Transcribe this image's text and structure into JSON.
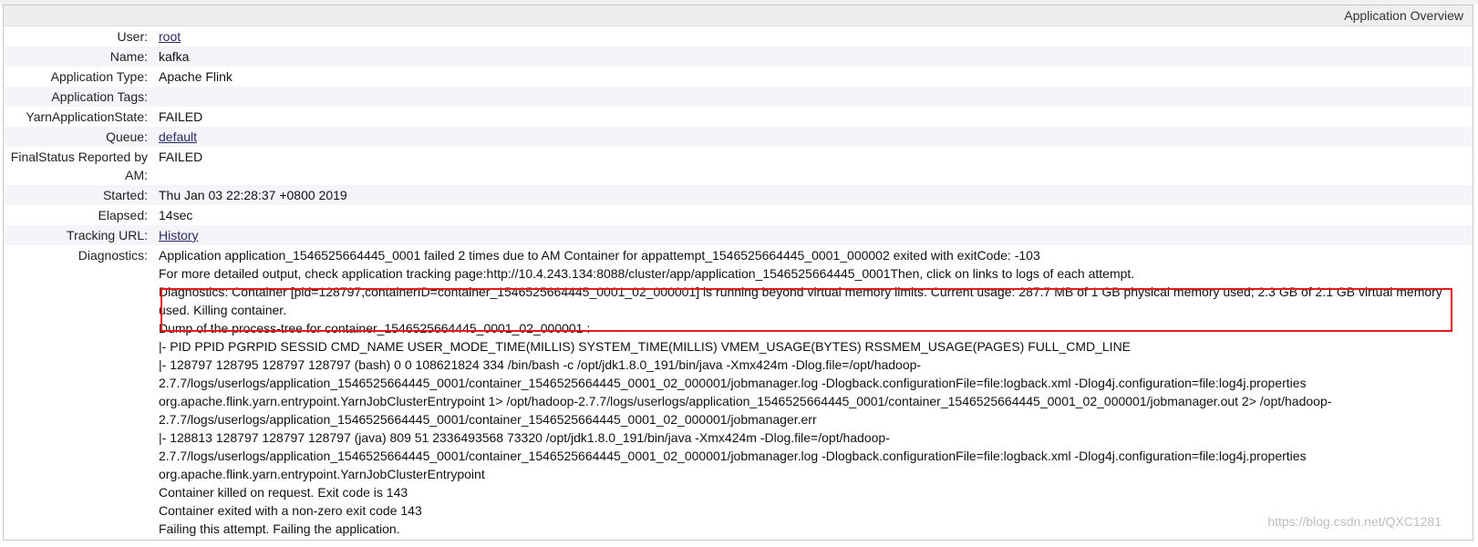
{
  "header": {
    "title": "Application Overview"
  },
  "fields": {
    "user": {
      "label": "User:",
      "value": "root"
    },
    "name": {
      "label": "Name:",
      "value": "kafka"
    },
    "app_type": {
      "label": "Application Type:",
      "value": "Apache Flink"
    },
    "app_tags": {
      "label": "Application Tags:",
      "value": ""
    },
    "yarn_state": {
      "label": "YarnApplicationState:",
      "value": "FAILED"
    },
    "queue": {
      "label": "Queue:",
      "value": "default"
    },
    "final_status": {
      "label": "FinalStatus Reported by AM:",
      "value": "FAILED"
    },
    "started": {
      "label": "Started:",
      "value": "Thu Jan 03 22:28:37 +0800 2019"
    },
    "elapsed": {
      "label": "Elapsed:",
      "value": "14sec"
    },
    "tracking_url": {
      "label": "Tracking URL:",
      "value": "History"
    },
    "diagnostics": {
      "label": "Diagnostics:",
      "lines": [
        "Application application_1546525664445_0001 failed 2 times due to AM Container for appattempt_1546525664445_0001_000002 exited with exitCode: -103",
        "For more detailed output, check application tracking page:http://10.4.243.134:8088/cluster/app/application_1546525664445_0001Then, click on links to logs of each attempt.",
        "Diagnostics: Container [pid=128797,containerID=container_1546525664445_0001_02_000001] is running beyond virtual memory limits. Current usage: 287.7 MB of 1 GB physical memory used; 2.3 GB of 2.1 GB virtual memory used. Killing container.",
        "Dump of the process-tree for container_1546525664445_0001_02_000001 :",
        "|- PID PPID PGRPID SESSID CMD_NAME USER_MODE_TIME(MILLIS) SYSTEM_TIME(MILLIS) VMEM_USAGE(BYTES) RSSMEM_USAGE(PAGES) FULL_CMD_LINE",
        "|- 128797 128795 128797 128797 (bash) 0 0 108621824 334 /bin/bash -c /opt/jdk1.8.0_191/bin/java -Xmx424m -Dlog.file=/opt/hadoop-2.7.7/logs/userlogs/application_1546525664445_0001/container_1546525664445_0001_02_000001/jobmanager.log -Dlogback.configurationFile=file:logback.xml -Dlog4j.configuration=file:log4j.properties org.apache.flink.yarn.entrypoint.YarnJobClusterEntrypoint 1> /opt/hadoop-2.7.7/logs/userlogs/application_1546525664445_0001/container_1546525664445_0001_02_000001/jobmanager.out 2> /opt/hadoop-2.7.7/logs/userlogs/application_1546525664445_0001/container_1546525664445_0001_02_000001/jobmanager.err",
        "|- 128813 128797 128797 128797 (java) 809 51 2336493568 73320 /opt/jdk1.8.0_191/bin/java -Xmx424m -Dlog.file=/opt/hadoop-2.7.7/logs/userlogs/application_1546525664445_0001/container_1546525664445_0001_02_000001/jobmanager.log -Dlogback.configurationFile=file:logback.xml -Dlog4j.configuration=file:log4j.properties org.apache.flink.yarn.entrypoint.YarnJobClusterEntrypoint",
        "Container killed on request. Exit code is 143",
        "Container exited with a non-zero exit code 143",
        "Failing this attempt. Failing the application."
      ]
    }
  },
  "watermark": "https://blog.csdn.net/QXC1281",
  "colors": {
    "highlight": "#e41b17",
    "alt_row": "#f5f5f9",
    "header_bg": "#eeeeee"
  }
}
